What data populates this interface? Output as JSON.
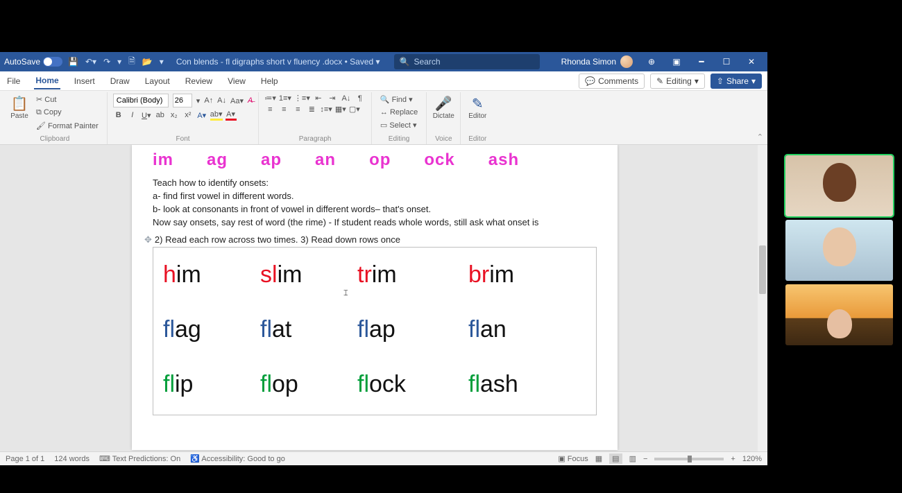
{
  "title_bar": {
    "autosave_label": "AutoSave",
    "doc_title": "Con blends - fl  digraphs short v fluency .docx • Saved ▾",
    "search_placeholder": "Search",
    "user_name": "Rhonda Simon"
  },
  "menu": {
    "file": "File",
    "home": "Home",
    "insert": "Insert",
    "draw": "Draw",
    "layout": "Layout",
    "review": "Review",
    "view": "View",
    "help": "Help",
    "comments": "Comments",
    "editing": "Editing",
    "share": "Share"
  },
  "ribbon": {
    "clipboard": {
      "paste": "Paste",
      "cut": "Cut",
      "copy": "Copy",
      "format_painter": "Format Painter",
      "label": "Clipboard"
    },
    "font": {
      "name_value": "Calibri (Body)",
      "size_value": "26",
      "label": "Font"
    },
    "paragraph": {
      "label": "Paragraph"
    },
    "editing_grp": {
      "find": "Find",
      "replace": "Replace",
      "select": "Select",
      "label": "Editing"
    },
    "voice": {
      "dictate": "Dictate",
      "label": "Voice"
    },
    "editor": {
      "editor": "Editor",
      "label": "Editor"
    }
  },
  "document": {
    "rimes": [
      "im",
      "ag",
      "ap",
      "an",
      "op",
      "ock",
      "ash"
    ],
    "instr_heading": "Teach how to identify onsets:",
    "instr_a": "a- find first vowel in different words.",
    "instr_b": "b- look at consonants in front of vowel in different words– that's onset.",
    "instr_c": "Now say onsets, say rest of word (the rime) - If student reads whole words, still ask what onset is",
    "task_line": "2) Read each row across two times.   3) Read down rows once",
    "rows": [
      [
        {
          "onset": "h",
          "rime": "im",
          "cls": "red"
        },
        {
          "onset": "sl",
          "rime": "im",
          "cls": "red"
        },
        {
          "onset": "tr",
          "rime": "im",
          "cls": "red"
        },
        {
          "onset": "br",
          "rime": "im",
          "cls": "red"
        }
      ],
      [
        {
          "onset": "fl",
          "rime": "ag",
          "cls": "blue"
        },
        {
          "onset": "fl",
          "rime": "at",
          "cls": "blue"
        },
        {
          "onset": "fl",
          "rime": "ap",
          "cls": "blue"
        },
        {
          "onset": "fl",
          "rime": "an",
          "cls": "blue"
        }
      ],
      [
        {
          "onset": "fl",
          "rime": "ip",
          "cls": "green"
        },
        {
          "onset": "fl",
          "rime": "op",
          "cls": "green"
        },
        {
          "onset": "fl",
          "rime": "ock",
          "cls": "green"
        },
        {
          "onset": "fl",
          "rime": "ash",
          "cls": "green"
        }
      ]
    ]
  },
  "status": {
    "page": "Page 1 of 1",
    "words": "124 words",
    "predictions": "Text Predictions: On",
    "accessibility": "Accessibility: Good to go",
    "focus": "Focus",
    "zoom": "120%"
  },
  "video": {
    "tiles": [
      "participant-1",
      "participant-2",
      "participant-3"
    ]
  }
}
